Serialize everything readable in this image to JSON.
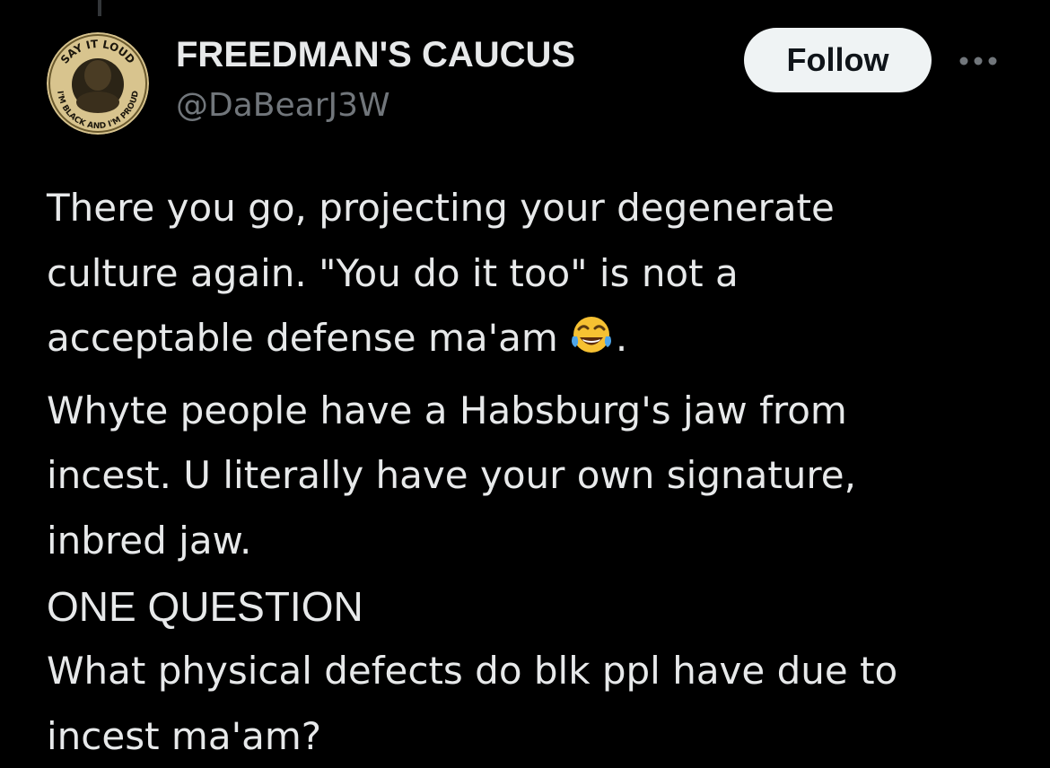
{
  "author": {
    "display_name": "FREEDMAN'S CAUCUS",
    "handle": "@DaBearJ3W",
    "avatar_text": {
      "top": "SAY IT LOUD",
      "bottom": "I'M BLACK AND I'M PROUD"
    }
  },
  "actions": {
    "follow_label": "Follow",
    "more_icon": "more-horizontal-icon"
  },
  "tweet": {
    "lines": [
      "There you go, projecting your degenerate",
      "culture again. \"You do it too\" is not a",
      "acceptable defense ma'am",
      "Whyte people have a Habsburg's jaw from",
      "incest. U literally have your own signature,",
      "inbred jaw.",
      "ONE QUESTION",
      "What physical defects do blk ppl have due to",
      "incest ma'am?"
    ],
    "emoji_icon": "tears-of-joy-emoji",
    "after_emoji": "."
  },
  "colors": {
    "background": "#000000",
    "text_primary": "#e7e9ea",
    "text_secondary": "#71767b",
    "follow_bg": "#eff3f4",
    "follow_text": "#0f1419"
  }
}
